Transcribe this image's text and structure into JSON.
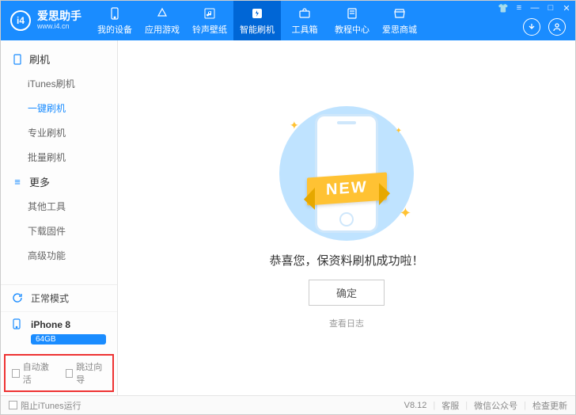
{
  "app": {
    "name": "爱思助手",
    "url": "www.i4.cn",
    "version": "V8.12"
  },
  "nav": [
    {
      "label": "我的设备",
      "icon": "phone"
    },
    {
      "label": "应用游戏",
      "icon": "app"
    },
    {
      "label": "铃声壁纸",
      "icon": "music"
    },
    {
      "label": "智能刷机",
      "icon": "flash",
      "active": true
    },
    {
      "label": "工具箱",
      "icon": "tools"
    },
    {
      "label": "教程中心",
      "icon": "book"
    },
    {
      "label": "爱思商城",
      "icon": "shop"
    }
  ],
  "sidebar": {
    "group1": {
      "title": "刷机",
      "items": [
        "iTunes刷机",
        "一键刷机",
        "专业刷机",
        "批量刷机"
      ],
      "activeIndex": 1
    },
    "group2": {
      "title": "更多",
      "items": [
        "其他工具",
        "下载固件",
        "高级功能"
      ]
    },
    "mode": "正常模式",
    "device": {
      "name": "iPhone 8",
      "storage": "64GB"
    },
    "checks": {
      "auto_activate": "自动激活",
      "skip_guide": "跳过向导"
    }
  },
  "main": {
    "ribbon": "NEW",
    "success": "恭喜您，保资料刷机成功啦！",
    "ok": "确定",
    "log": "查看日志"
  },
  "footer": {
    "block_itunes": "阻止iTunes运行",
    "links": [
      "客服",
      "微信公众号",
      "检查更新"
    ]
  }
}
